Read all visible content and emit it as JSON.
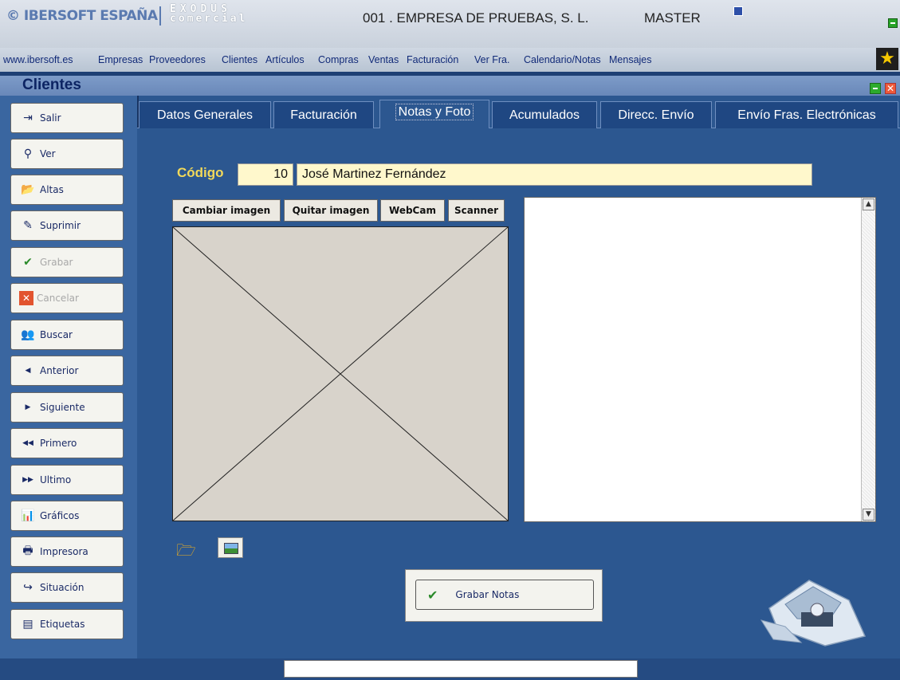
{
  "header": {
    "brand": "© IBERSOFT ESPAÑA",
    "product_line1": "EXODUS",
    "product_line2": "comercial",
    "company": "001 . EMPRESA DE PRUEBAS, S. L.",
    "user": "MASTER"
  },
  "menu": [
    "www.ibersoft.es",
    "Empresas",
    "Proveedores",
    "Clientes",
    "Artículos",
    "Compras",
    "Ventas",
    "Facturación",
    "Ver Fra.",
    "Calendario/Notas",
    "Mensajes"
  ],
  "window": {
    "title": "Clientes"
  },
  "sidebar": [
    {
      "label": "Salir",
      "icon": "exit-icon",
      "enabled": true
    },
    {
      "label": "Ver",
      "icon": "magnifier-icon",
      "enabled": true
    },
    {
      "label": "Altas",
      "icon": "folder-open-icon",
      "enabled": true
    },
    {
      "label": "Suprimir",
      "icon": "eraser-icon",
      "enabled": true
    },
    {
      "label": "Grabar",
      "icon": "checkmark-icon",
      "enabled": false
    },
    {
      "label": "Cancelar",
      "icon": "cancel-icon",
      "enabled": false
    },
    {
      "label": "Buscar",
      "icon": "people-search-icon",
      "enabled": true
    },
    {
      "label": "Anterior",
      "icon": "arrow-left-icon",
      "enabled": true
    },
    {
      "label": "Siguiente",
      "icon": "arrow-right-icon",
      "enabled": true
    },
    {
      "label": "Primero",
      "icon": "arrow-first-icon",
      "enabled": true
    },
    {
      "label": "Ultimo",
      "icon": "arrow-last-icon",
      "enabled": true
    },
    {
      "label": "Gráficos",
      "icon": "chart-icon",
      "enabled": true
    },
    {
      "label": "Impresora",
      "icon": "printer-icon",
      "enabled": true
    },
    {
      "label": "Situación",
      "icon": "situation-icon",
      "enabled": true
    },
    {
      "label": "Etiquetas",
      "icon": "labels-icon",
      "enabled": true
    }
  ],
  "tabs": [
    {
      "label": "Datos Generales",
      "active": false
    },
    {
      "label": "Facturación",
      "active": false
    },
    {
      "label": "Notas y Foto",
      "active": true
    },
    {
      "label": "Acumulados",
      "active": false
    },
    {
      "label": "Direcc. Envío",
      "active": false
    },
    {
      "label": "Envío Fras. Electrónicas",
      "active": false
    }
  ],
  "form": {
    "codigo_label": "Código",
    "codigo_value": "10",
    "nombre_value": "José Martinez Fernández"
  },
  "image_buttons": {
    "change": "Cambiar imagen",
    "remove": "Quitar imagen",
    "webcam": "WebCam",
    "scanner": "Scanner"
  },
  "notes": {
    "value": ""
  },
  "save_notes_label": "Grabar Notas",
  "colors": {
    "accent_label": "#f2d95a",
    "panel_bg": "#2c5790",
    "input_bg": "#fff8cc"
  }
}
